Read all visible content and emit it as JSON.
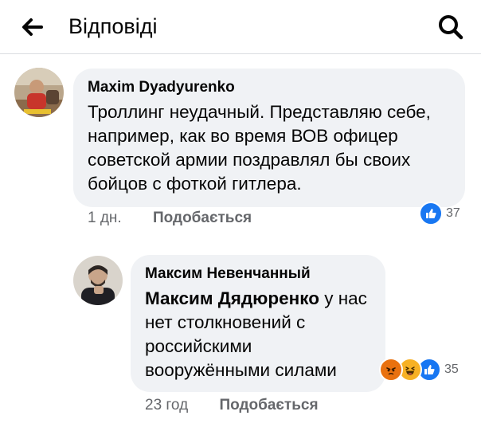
{
  "header": {
    "title": "Відповіді",
    "back_icon": "arrow-left-icon",
    "search_icon": "search-icon"
  },
  "comments": [
    {
      "author": "Maxim  Dyadyurenko",
      "text": "Троллинг неудачный. Представляю себе, например, как во время ВОВ офицер советской армии поздравлял бы своих бойцов с фоткой гитлера.",
      "time": "1 дн.",
      "like_label": "Подобається",
      "reactions": [
        "like"
      ],
      "reaction_count": "37"
    },
    {
      "author": "Максим Невенчанный",
      "mention": "Максим Дядюренко",
      "text": " у нас нет столкновений с российскими вооружёнными силами",
      "time": "23 год",
      "like_label": "Подобається",
      "reactions": [
        "angry",
        "haha",
        "like"
      ],
      "reaction_count": "35"
    }
  ],
  "colors": {
    "bubble": "#f0f2f5",
    "meta_text": "#65676b",
    "like_blue": "#1877f2",
    "angry": "#e9710f",
    "haha": "#f7b125"
  }
}
